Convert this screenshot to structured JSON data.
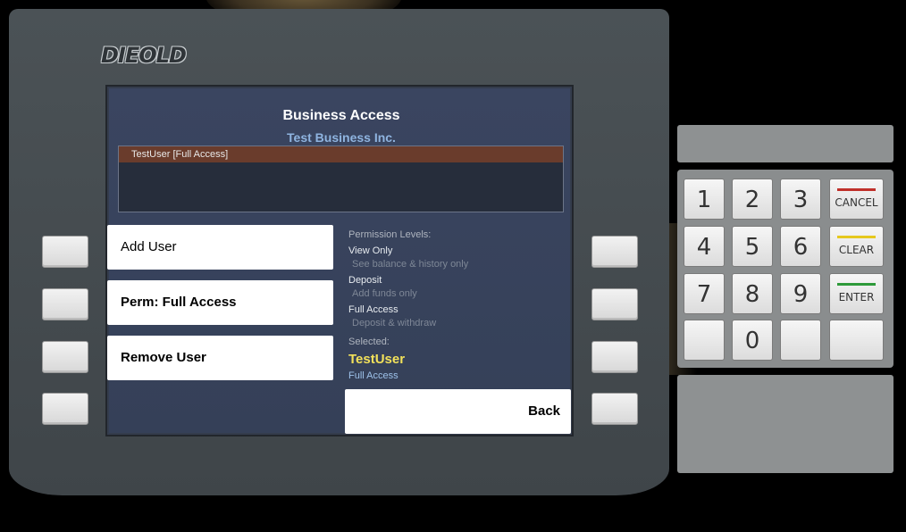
{
  "logo": "DIEOLD",
  "screen": {
    "title": "Business Access",
    "subtitle": "Test Business Inc.",
    "user_list": [
      {
        "label": "TestUser  [Full Access]"
      }
    ],
    "buttons": {
      "add_user": "Add User",
      "perm": "Perm: Full Access",
      "remove_user": "Remove User",
      "back": "Back"
    },
    "permissions": {
      "heading": "Permission Levels:",
      "levels": [
        {
          "name": "View Only",
          "desc": "See balance & history only"
        },
        {
          "name": "Deposit",
          "desc": "Add funds only"
        },
        {
          "name": "Full Access",
          "desc": "Deposit & withdraw"
        }
      ],
      "selected_label": "Selected:",
      "selected_user": "TestUser",
      "selected_perm": "Full Access"
    }
  },
  "keypad": {
    "digits": [
      "1",
      "2",
      "3",
      "4",
      "5",
      "6",
      "7",
      "8",
      "9",
      "0"
    ],
    "cancel": "CANCEL",
    "clear": "CLEAR",
    "enter": "ENTER",
    "colors": {
      "cancel": "#c0302a",
      "clear": "#e6c81e",
      "enter": "#2e9a3a"
    }
  }
}
